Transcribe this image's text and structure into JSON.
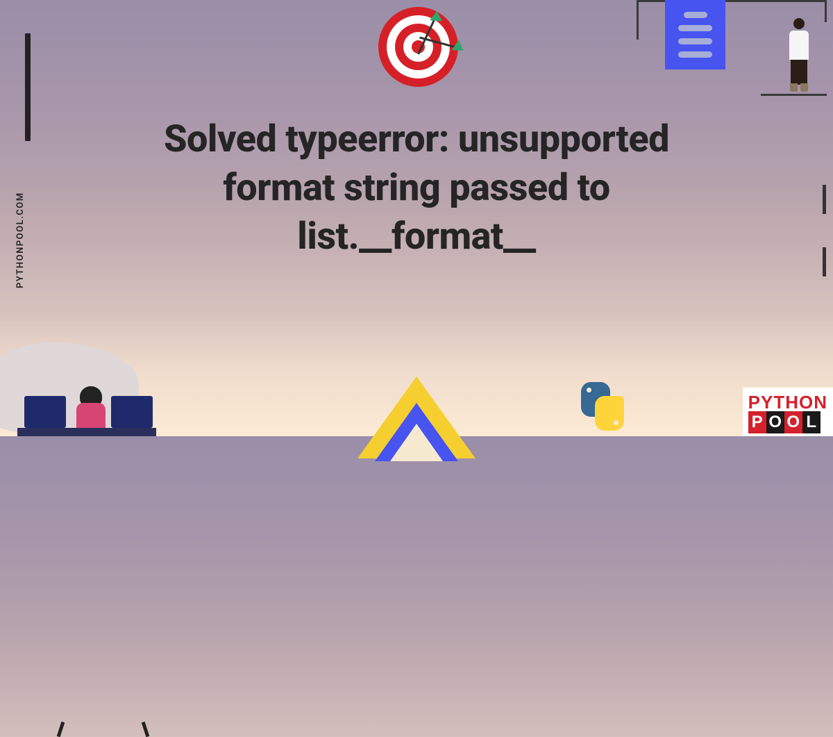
{
  "title": "Solved typeerror: unsupported format string passed to list.__format__",
  "site_vertical": "PYTHONPOOL.COM",
  "logo": {
    "row1": "PYTHON",
    "row2": [
      "P",
      "O",
      "O",
      "L"
    ]
  }
}
